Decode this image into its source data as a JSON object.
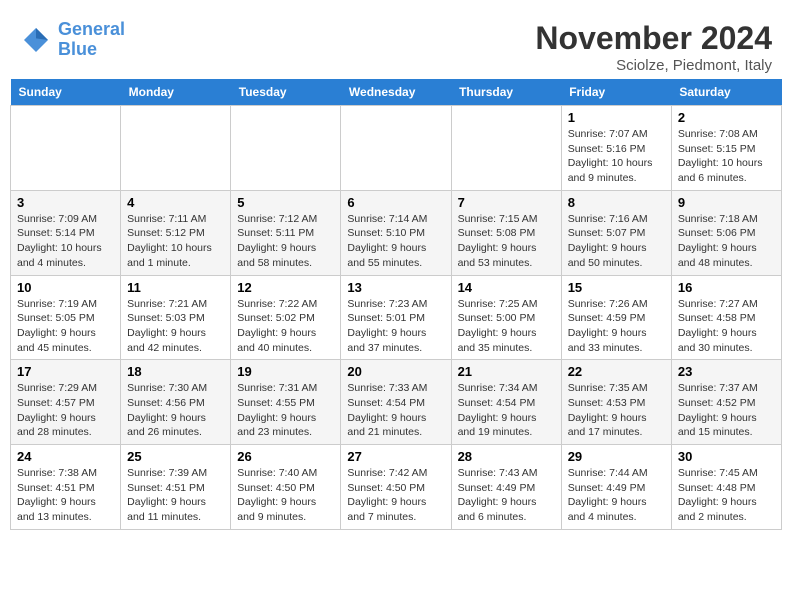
{
  "header": {
    "logo_line1": "General",
    "logo_line2": "Blue",
    "month": "November 2024",
    "location": "Sciolze, Piedmont, Italy"
  },
  "days_of_week": [
    "Sunday",
    "Monday",
    "Tuesday",
    "Wednesday",
    "Thursday",
    "Friday",
    "Saturday"
  ],
  "weeks": [
    [
      {
        "day": "",
        "info": ""
      },
      {
        "day": "",
        "info": ""
      },
      {
        "day": "",
        "info": ""
      },
      {
        "day": "",
        "info": ""
      },
      {
        "day": "",
        "info": ""
      },
      {
        "day": "1",
        "info": "Sunrise: 7:07 AM\nSunset: 5:16 PM\nDaylight: 10 hours and 9 minutes."
      },
      {
        "day": "2",
        "info": "Sunrise: 7:08 AM\nSunset: 5:15 PM\nDaylight: 10 hours and 6 minutes."
      }
    ],
    [
      {
        "day": "3",
        "info": "Sunrise: 7:09 AM\nSunset: 5:14 PM\nDaylight: 10 hours and 4 minutes."
      },
      {
        "day": "4",
        "info": "Sunrise: 7:11 AM\nSunset: 5:12 PM\nDaylight: 10 hours and 1 minute."
      },
      {
        "day": "5",
        "info": "Sunrise: 7:12 AM\nSunset: 5:11 PM\nDaylight: 9 hours and 58 minutes."
      },
      {
        "day": "6",
        "info": "Sunrise: 7:14 AM\nSunset: 5:10 PM\nDaylight: 9 hours and 55 minutes."
      },
      {
        "day": "7",
        "info": "Sunrise: 7:15 AM\nSunset: 5:08 PM\nDaylight: 9 hours and 53 minutes."
      },
      {
        "day": "8",
        "info": "Sunrise: 7:16 AM\nSunset: 5:07 PM\nDaylight: 9 hours and 50 minutes."
      },
      {
        "day": "9",
        "info": "Sunrise: 7:18 AM\nSunset: 5:06 PM\nDaylight: 9 hours and 48 minutes."
      }
    ],
    [
      {
        "day": "10",
        "info": "Sunrise: 7:19 AM\nSunset: 5:05 PM\nDaylight: 9 hours and 45 minutes."
      },
      {
        "day": "11",
        "info": "Sunrise: 7:21 AM\nSunset: 5:03 PM\nDaylight: 9 hours and 42 minutes."
      },
      {
        "day": "12",
        "info": "Sunrise: 7:22 AM\nSunset: 5:02 PM\nDaylight: 9 hours and 40 minutes."
      },
      {
        "day": "13",
        "info": "Sunrise: 7:23 AM\nSunset: 5:01 PM\nDaylight: 9 hours and 37 minutes."
      },
      {
        "day": "14",
        "info": "Sunrise: 7:25 AM\nSunset: 5:00 PM\nDaylight: 9 hours and 35 minutes."
      },
      {
        "day": "15",
        "info": "Sunrise: 7:26 AM\nSunset: 4:59 PM\nDaylight: 9 hours and 33 minutes."
      },
      {
        "day": "16",
        "info": "Sunrise: 7:27 AM\nSunset: 4:58 PM\nDaylight: 9 hours and 30 minutes."
      }
    ],
    [
      {
        "day": "17",
        "info": "Sunrise: 7:29 AM\nSunset: 4:57 PM\nDaylight: 9 hours and 28 minutes."
      },
      {
        "day": "18",
        "info": "Sunrise: 7:30 AM\nSunset: 4:56 PM\nDaylight: 9 hours and 26 minutes."
      },
      {
        "day": "19",
        "info": "Sunrise: 7:31 AM\nSunset: 4:55 PM\nDaylight: 9 hours and 23 minutes."
      },
      {
        "day": "20",
        "info": "Sunrise: 7:33 AM\nSunset: 4:54 PM\nDaylight: 9 hours and 21 minutes."
      },
      {
        "day": "21",
        "info": "Sunrise: 7:34 AM\nSunset: 4:54 PM\nDaylight: 9 hours and 19 minutes."
      },
      {
        "day": "22",
        "info": "Sunrise: 7:35 AM\nSunset: 4:53 PM\nDaylight: 9 hours and 17 minutes."
      },
      {
        "day": "23",
        "info": "Sunrise: 7:37 AM\nSunset: 4:52 PM\nDaylight: 9 hours and 15 minutes."
      }
    ],
    [
      {
        "day": "24",
        "info": "Sunrise: 7:38 AM\nSunset: 4:51 PM\nDaylight: 9 hours and 13 minutes."
      },
      {
        "day": "25",
        "info": "Sunrise: 7:39 AM\nSunset: 4:51 PM\nDaylight: 9 hours and 11 minutes."
      },
      {
        "day": "26",
        "info": "Sunrise: 7:40 AM\nSunset: 4:50 PM\nDaylight: 9 hours and 9 minutes."
      },
      {
        "day": "27",
        "info": "Sunrise: 7:42 AM\nSunset: 4:50 PM\nDaylight: 9 hours and 7 minutes."
      },
      {
        "day": "28",
        "info": "Sunrise: 7:43 AM\nSunset: 4:49 PM\nDaylight: 9 hours and 6 minutes."
      },
      {
        "day": "29",
        "info": "Sunrise: 7:44 AM\nSunset: 4:49 PM\nDaylight: 9 hours and 4 minutes."
      },
      {
        "day": "30",
        "info": "Sunrise: 7:45 AM\nSunset: 4:48 PM\nDaylight: 9 hours and 2 minutes."
      }
    ]
  ]
}
